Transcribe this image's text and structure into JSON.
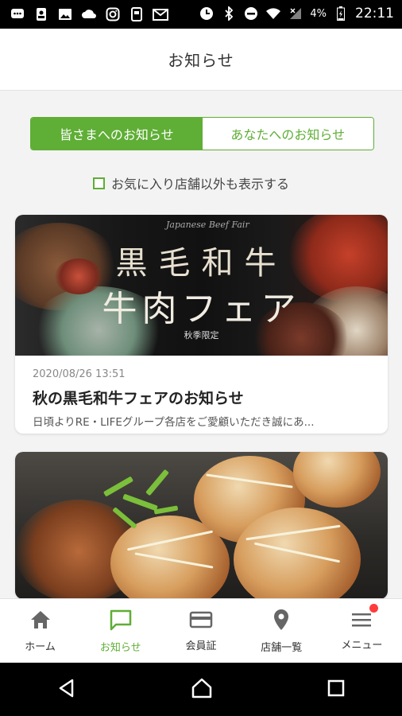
{
  "status_bar": {
    "battery_percent": "4%",
    "time": "22:11",
    "icons": [
      "chat-icon",
      "contact-icon",
      "image-icon",
      "cloud-icon",
      "instagram-icon",
      "app-icon",
      "mail-icon",
      "sync-icon",
      "bluetooth-icon",
      "do-not-disturb-icon",
      "wifi-icon",
      "signal-icon",
      "battery-icon"
    ]
  },
  "header": {
    "title": "お知らせ"
  },
  "tabs": [
    {
      "label": "皆さまへのお知らせ",
      "active": true
    },
    {
      "label": "あなたへのお知らせ",
      "active": false
    }
  ],
  "filter": {
    "label": "お気に入り店舗以外も表示する",
    "checked": false
  },
  "cards": [
    {
      "banner": {
        "subtitle": "Japanese Beef Fair",
        "title_line1": "黒毛和牛",
        "title_line2": "牛肉フェア",
        "limited": "秋季限定"
      },
      "date": "2020/08/26 13:51",
      "title": "秋の黒毛和牛フェアのお知らせ",
      "excerpt": "日頃よりRE・LIFEグループ各店をご愛顧いただき誠にあ..."
    },
    {
      "image": "takoyaki-photo"
    }
  ],
  "bottom_nav": [
    {
      "label": "ホーム",
      "icon": "home-icon",
      "active": false
    },
    {
      "label": "お知らせ",
      "icon": "message-icon",
      "active": true
    },
    {
      "label": "会員証",
      "icon": "card-icon",
      "active": false
    },
    {
      "label": "店舗一覧",
      "icon": "location-icon",
      "active": false
    },
    {
      "label": "メニュー",
      "icon": "menu-icon",
      "active": false,
      "badge": true
    }
  ],
  "colors": {
    "accent": "#5fae36",
    "badge": "#ff3b3b"
  }
}
